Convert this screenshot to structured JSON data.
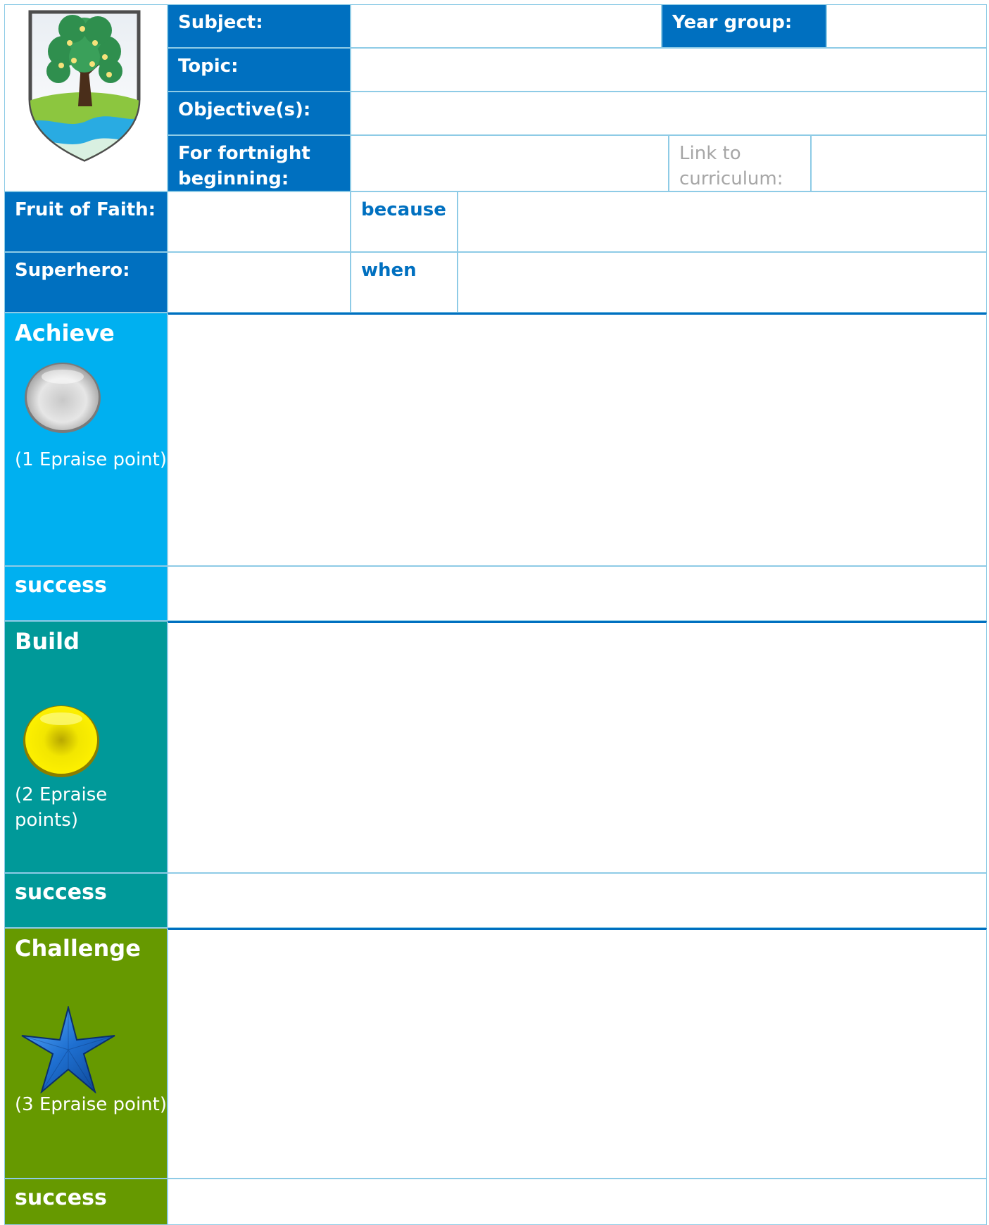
{
  "header": {
    "subject_label": "Subject:",
    "subject_value": "",
    "year_group_label": "Year group:",
    "year_group_value": "",
    "topic_label": "Topic:",
    "topic_value": "",
    "objective_label": "Objective(s):",
    "objective_value": "",
    "fortnight_label_line1": "For fortnight",
    "fortnight_label_line2": "beginning:",
    "fortnight_value": "",
    "curriculum_label_line1": "Link to",
    "curriculum_label_line2": "curriculum:",
    "curriculum_value": ""
  },
  "values": {
    "fruit_label": "Fruit of Faith:",
    "fruit_value": "",
    "because_label": "because",
    "because_value": "",
    "superhero_label": "Superhero:",
    "superhero_value": "",
    "when_label": "when",
    "when_value": ""
  },
  "sections": {
    "achieve": {
      "title": "Achieve",
      "points": "(1 Epraise point)",
      "icon": "silver-circle-icon",
      "content": "",
      "success_label": "success",
      "success_value": ""
    },
    "build": {
      "title": "Build",
      "points_line1": "(2 Epraise",
      "points_line2": "points)",
      "icon": "gold-circle-icon",
      "content": "",
      "success_label": "success",
      "success_value": ""
    },
    "challenge": {
      "title": "Challenge",
      "points": "(3 Epraise point)",
      "icon": "blue-star-icon",
      "content": "",
      "success_label": "success",
      "success_value": ""
    }
  },
  "colors": {
    "dark_blue": "#0070c0",
    "sky_blue": "#00b0f0",
    "teal": "#009999",
    "green": "#669900",
    "border": "#8ecbe6"
  }
}
